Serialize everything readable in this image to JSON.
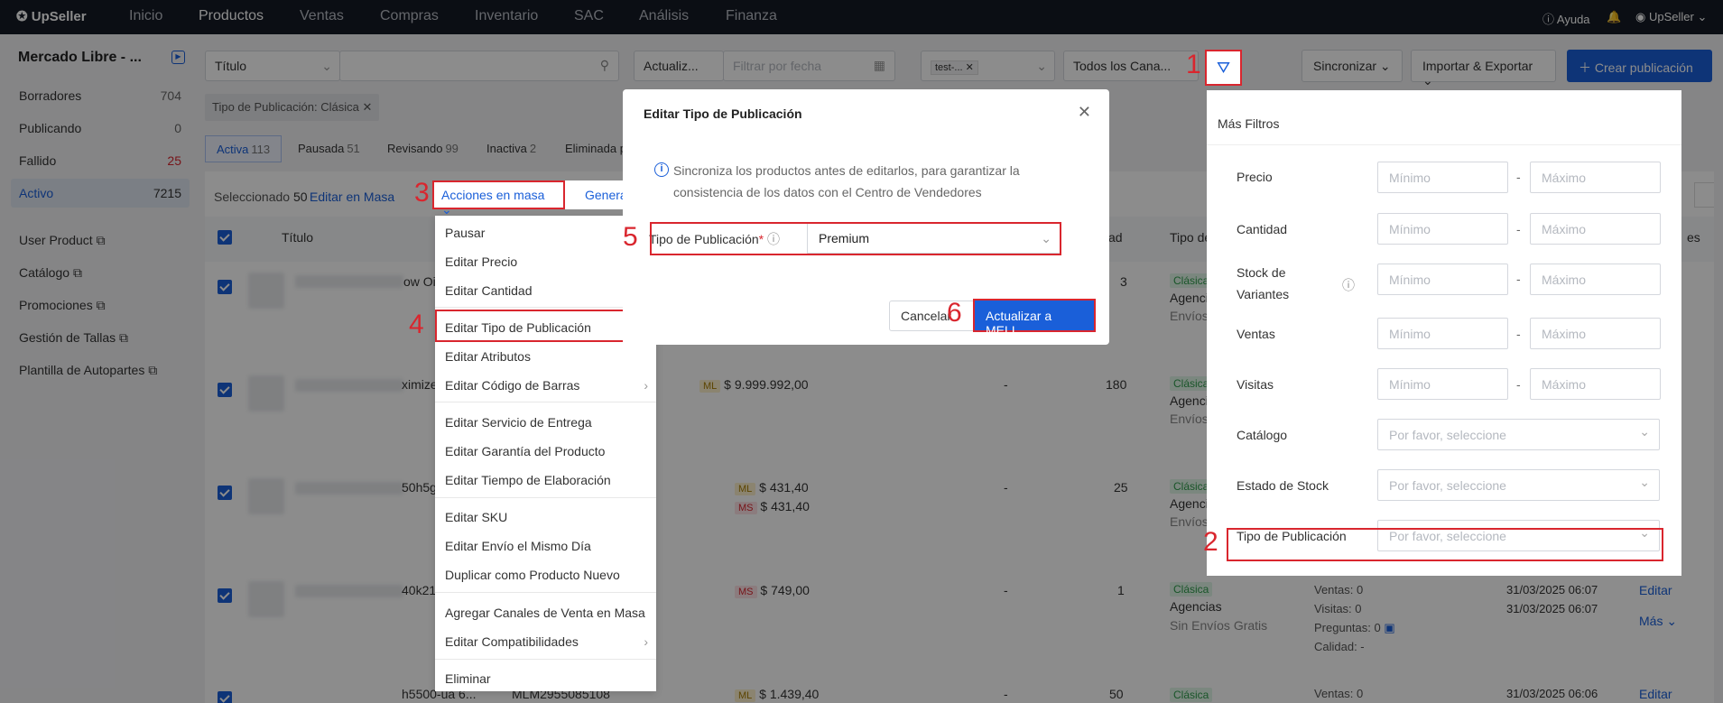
{
  "nav": {
    "logo": "UpSeller",
    "items": [
      "Inicio",
      "Productos",
      "Ventas",
      "Compras",
      "Inventario",
      "SAC",
      "Análisis",
      "Finanza"
    ],
    "help": "Ayuda",
    "user": "UpSeller"
  },
  "sidebar": {
    "store": "Mercado Libre - ...",
    "statuses": [
      {
        "label": "Borradores",
        "count": "704"
      },
      {
        "label": "Publicando",
        "count": "0"
      },
      {
        "label": "Fallido",
        "count": "25"
      },
      {
        "label": "Activo",
        "count": "7215"
      }
    ],
    "links": [
      "User Product",
      "Catálogo",
      "Promociones",
      "Gestión de Tallas",
      "Plantilla de Autopartes"
    ]
  },
  "toolbar": {
    "search_type": "Título",
    "date_type": "Actualiz...",
    "date_placeholder": "Filtrar por fecha",
    "store_tag": "test-...",
    "channels": "Todos los Cana...",
    "sync": "Sincronizar",
    "import_export": "Importar & Exportar",
    "create": "Crear publicación"
  },
  "active_filter_tag": "Tipo de Publicación: Clásica",
  "tabs": [
    {
      "label": "Activa",
      "count": "113"
    },
    {
      "label": "Pausada",
      "count": "51"
    },
    {
      "label": "Revisando",
      "count": "99"
    },
    {
      "label": "Inactiva",
      "count": "2"
    },
    {
      "label": "Eliminada p",
      "count": ""
    }
  ],
  "bulk_bar": {
    "selected_label": "Seleccionado",
    "selected_count": "50",
    "edit_bulk": "Editar en Masa",
    "bulk_actions": "Acciones en masa",
    "generate": "Genera"
  },
  "table": {
    "col_title": "Título",
    "col_qty_partial": "ad",
    "col_type_partial": "Tipo de P",
    "col_right_partial": "es",
    "rows": [
      {
        "title_partial": "ow Oil",
        "prices": [],
        "dash": "",
        "qty": "3",
        "type": "Clásica",
        "shipping": "Agencias",
        "free": "Envíos G",
        "stats": [],
        "dates": [],
        "actions": []
      },
      {
        "title_partial": "ximize",
        "prices": [
          {
            "badge": "ML",
            "value": "$ 9.999.992,00"
          }
        ],
        "dash": "-",
        "qty": "180",
        "type": "Clásica",
        "shipping": "Agencias",
        "free": "Envíos G",
        "stats": [],
        "dates": [],
        "actions": []
      },
      {
        "title_partial": "50h5gu",
        "prices": [
          {
            "badge": "ML",
            "value": "$ 431,40"
          },
          {
            "badge": "MS",
            "value": "$ 431,40"
          }
        ],
        "dash": "-",
        "qty": "25",
        "type": "Clásica",
        "shipping": "Agencias",
        "free": "Envíos G",
        "stats": [],
        "dates": [],
        "actions": []
      },
      {
        "title_partial": "40k21c",
        "prices": [
          {
            "badge": "MS",
            "value": "$ 749,00"
          }
        ],
        "dash": "-",
        "qty": "1",
        "type": "Clásica",
        "shipping": "Agencias",
        "free": "Sin Envíos Gratis",
        "stats": [
          "Ventas: 0",
          "Visitas: 0",
          "Preguntas: 0",
          "Calidad: -"
        ],
        "dates": [
          "31/03/2025 06:07",
          "31/03/2025 06:07"
        ],
        "actions": [
          "Editar",
          "Más"
        ]
      },
      {
        "title_partial": "h5500-ua 6...",
        "sku": "MLM2955085108",
        "prices": [
          {
            "badge": "ML",
            "value": "$ 1.439,40"
          }
        ],
        "dash": "-",
        "qty": "50",
        "type": "Clásica",
        "shipping": "",
        "free": "",
        "stats": [
          "Ventas: 0"
        ],
        "dates": [
          "31/03/2025 06:06"
        ],
        "actions": [
          "Editar"
        ]
      }
    ]
  },
  "bulk_menu": {
    "items": [
      "Pausar",
      "Editar Precio",
      "Editar Cantidad",
      "Editar Tipo de Publicación",
      "Editar Atributos",
      "Editar Código de Barras",
      "Editar Servicio de Entrega",
      "Editar Garantía del Producto",
      "Editar Tiempo de Elaboración",
      "Editar SKU",
      "Editar Envío el Mismo Día",
      "Duplicar como Producto Nuevo",
      "Agregar Canales de Venta en Masa",
      "Editar Compatibilidades",
      "Eliminar"
    ]
  },
  "modal": {
    "title": "Editar Tipo de Publicación",
    "notice_line1": "Sincroniza los productos antes de editarlos, para garantizar la",
    "notice_line2": "consistencia de los datos con el Centro de Vendedores",
    "field_label": "Tipo de Publicación",
    "field_value": "Premium",
    "cancel": "Cancelar",
    "submit": "Actualizar a MELI"
  },
  "filter_panel": {
    "title": "Más Filtros",
    "min_placeholder": "Mínimo",
    "max_placeholder": "Máximo",
    "select_placeholder": "Por favor, seleccione",
    "range_fields": [
      "Precio",
      "Cantidad",
      "Stock de Variantes",
      "Ventas",
      "Visitas"
    ],
    "select_fields": [
      "Catálogo",
      "Estado de Stock",
      "Tipo de Publicación"
    ]
  },
  "steps": [
    "1",
    "2",
    "3",
    "4",
    "5",
    "6"
  ],
  "colors": {
    "primary": "#1a5fd9",
    "highlight": "#d9262e",
    "nav_bg": "#151b26"
  }
}
